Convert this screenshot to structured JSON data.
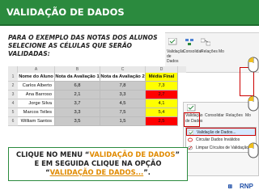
{
  "header": {
    "title": "VALIDAÇÃO DE DADOS"
  },
  "instruction": "PARA O EXEMPLO DAS NOTAS DOS ALUNOS SELECIONE AS CÉLULAS QUE SERÃO VALIDADAS:",
  "ribbon": {
    "items": [
      "Validação de Dados",
      "Consolidar",
      "Relações",
      "Mo"
    ]
  },
  "sheet": {
    "col_letters": [
      "A",
      "B",
      "C",
      "D"
    ],
    "row_numbers": [
      "1",
      "2",
      "3",
      "4",
      "5",
      "6"
    ],
    "headers": [
      "Nome do Aluno",
      "Nota da Avaliação 1",
      "Nota da Avaliação 2",
      "Média Final"
    ],
    "rows": [
      {
        "name": "Carlos Alberto",
        "a1": "6,8",
        "a2": "7,8",
        "mf": "7,3",
        "mf_status": "ok"
      },
      {
        "name": "Ana Barroso",
        "a1": "2,1",
        "a2": "3,3",
        "mf": "2,7",
        "mf_status": "bad"
      },
      {
        "name": "Jorge Silva",
        "a1": "3,7",
        "a2": "4,5",
        "mf": "4,1",
        "mf_status": "ok"
      },
      {
        "name": "Marcos Telles",
        "a1": "3,3",
        "a2": "7,5",
        "mf": "5,4",
        "mf_status": "ok"
      },
      {
        "name": "William Santos",
        "a1": "3,5",
        "a2": "1,5",
        "mf": "2,5",
        "mf_status": "bad"
      }
    ]
  },
  "validation_menu": {
    "ribbon_labels": [
      "Validação",
      "de Dados",
      "Consolidar",
      "Relações",
      "Mo"
    ],
    "items": [
      {
        "label": "Validação de Dados...",
        "active": true
      },
      {
        "label": "Circular Dados Inválidos",
        "active": false
      },
      {
        "label": "Limpar Círculos de Validação",
        "active": false
      }
    ]
  },
  "callout": {
    "part1": "CLIQUE NO MENU “",
    "link1": "VALIDAÇÃO DE DADOS",
    "part2": "”",
    "part3": "E EM SEGUIDA CLIQUE NA OPÇÃO",
    "part4": "“",
    "link2": "VALIDAÇÃO DE DADOS...",
    "part5": "”."
  },
  "logo": {
    "text": "RNP"
  },
  "colors": {
    "brand_green": "#2b8a3e",
    "highlight_orange": "#e08a00",
    "ok_yellow": "#ffff00",
    "bad_red": "#ff0000"
  }
}
